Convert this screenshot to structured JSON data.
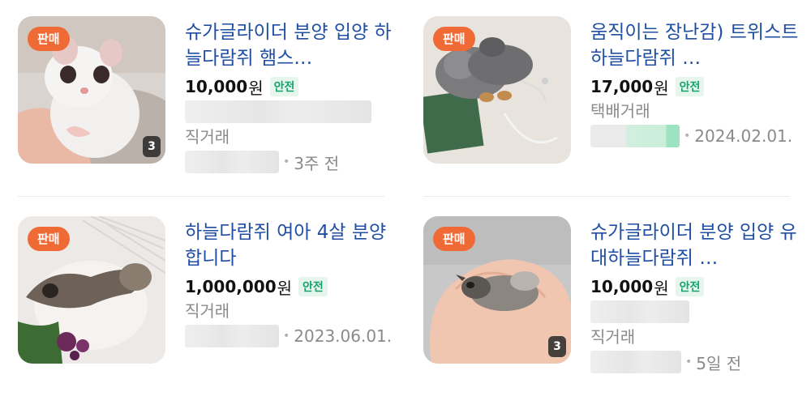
{
  "listings": [
    {
      "status_badge": "판매",
      "title": "슈가글라이더 분양 입양 하늘다람쥐 햄스…",
      "price": "10,000",
      "currency": "원",
      "safe_label": "안전",
      "trade_type": "직거래",
      "date": "3주 전",
      "photo_count": "3"
    },
    {
      "status_badge": "판매",
      "title": "움직이는 장난감) 트위스트 하늘다람쥐 …",
      "price": "17,000",
      "currency": "원",
      "safe_label": "안전",
      "trade_type": "택배거래",
      "date": "2024.02.01."
    },
    {
      "status_badge": "판매",
      "title": "하늘다람쥐 여아 4살 분양합니다",
      "price": "1,000,000",
      "currency": "원",
      "safe_label": "안전",
      "trade_type": "직거래",
      "date": "2023.06.01."
    },
    {
      "status_badge": "판매",
      "title": "슈가글라이더 분양 입양 유대하늘다람쥐 …",
      "price": "10,000",
      "currency": "원",
      "safe_label": "안전",
      "trade_type": "직거래",
      "date": "5일 전",
      "photo_count": "3"
    }
  ],
  "meta_separator": "•",
  "colors": {
    "title": "#1f4ea3",
    "sale_badge": "#f06a35",
    "safe_text": "#16a36b",
    "safe_bg": "#e6f6ee",
    "muted": "#8a8a8a"
  }
}
